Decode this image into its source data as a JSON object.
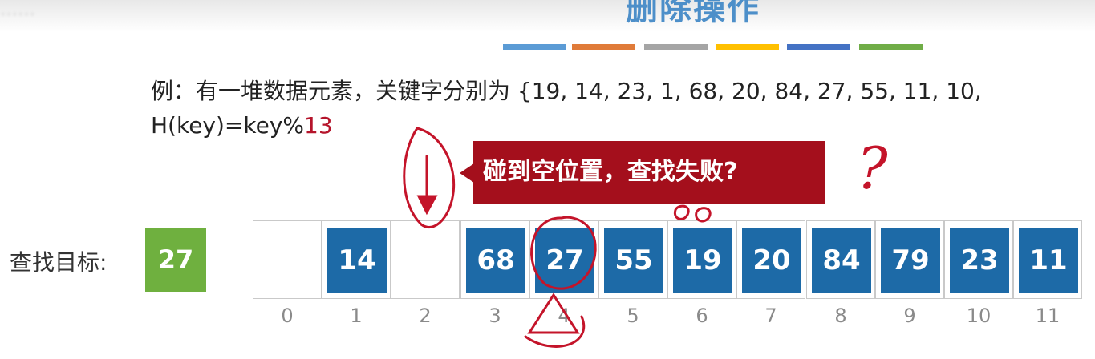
{
  "header": {
    "title": "删除操作",
    "faded_text": "……",
    "color_bars": [
      "#5b9bd5",
      "#e07b39",
      "#a5a5a5",
      "#ffc000",
      "#4472c4",
      "#70ad47"
    ]
  },
  "example": {
    "text": "例：有一堆数据元素，关键字分别为 {19, 14, 23, 1, 68, 20, 84, 27, 55, 11, 10,",
    "hash_prefix": "H(key)=key%",
    "hash_mod": "13"
  },
  "callout": {
    "text": "碰到空位置，查找失败?"
  },
  "annotations": {
    "question_mark": "?"
  },
  "search": {
    "label": "查找目标:",
    "target": "27"
  },
  "table": {
    "cells": [
      {
        "index": "0",
        "value": ""
      },
      {
        "index": "1",
        "value": "14"
      },
      {
        "index": "2",
        "value": ""
      },
      {
        "index": "3",
        "value": "68"
      },
      {
        "index": "4",
        "value": "27"
      },
      {
        "index": "5",
        "value": "55"
      },
      {
        "index": "6",
        "value": "19"
      },
      {
        "index": "7",
        "value": "20"
      },
      {
        "index": "8",
        "value": "84"
      },
      {
        "index": "9",
        "value": "79"
      },
      {
        "index": "10",
        "value": "23"
      },
      {
        "index": "11",
        "value": "11"
      }
    ]
  }
}
